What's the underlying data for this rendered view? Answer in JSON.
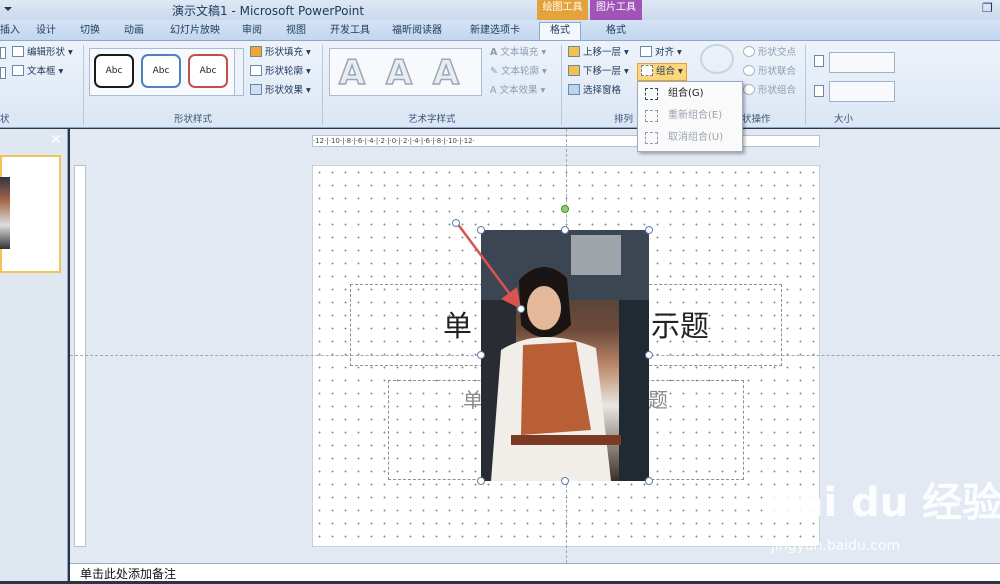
{
  "titlebar": {
    "title": "演示文稿1 - Microsoft PowerPoint",
    "restore_glyph": "❐",
    "contexts": {
      "drawing_tools": "绘图工具",
      "picture_tools": "图片工具"
    }
  },
  "tabs": [
    "插入",
    "设计",
    "切换",
    "动画",
    "幻灯片放映",
    "审阅",
    "视图",
    "开发工具",
    "福昕阅读器",
    "新建选项卡",
    "格式",
    "格式"
  ],
  "active_tab": "格式",
  "ribbon": {
    "insert_shapes": {
      "edit_shape": "编辑形状",
      "textbox": "文本框",
      "label": "状"
    },
    "shape_styles": {
      "thumb_labels": [
        "Abc",
        "Abc",
        "Abc"
      ],
      "fill": "形状填充",
      "outline": "形状轮廓",
      "effects": "形状效果",
      "label": "形状样式",
      "thumb_colors": [
        "#1a1a1a",
        "#4f81bd",
        "#c0504d"
      ]
    },
    "wordart": {
      "letters": [
        "A",
        "A",
        "A"
      ],
      "text_fill": "文本填充",
      "text_outline": "文本轮廓",
      "text_effects": "文本效果",
      "label": "艺术字样式"
    },
    "arrange": {
      "bring_forward": "上移一层",
      "send_backward": "下移一层",
      "selection_pane": "选择窗格",
      "align": "对齐",
      "group": "组合",
      "label": "排列"
    },
    "shape_ops": {
      "intersect": "形状交点",
      "union": "形状联合",
      "combine": "形状组合",
      "label": "状操作"
    },
    "size": {
      "label": "大小"
    }
  },
  "group_menu": {
    "items": [
      {
        "label": "组合(G)",
        "enabled": true
      },
      {
        "label": "重新组合(E)",
        "enabled": false
      },
      {
        "label": "取消组合(U)",
        "enabled": false
      }
    ]
  },
  "slide_panel": {
    "close": "✕"
  },
  "ruler": {
    "h_text": "·12·|·10·|·8·|·6·|·4·|·2·|·0·|·2·|·4·|·6·|·8·|·10·|·12·"
  },
  "slide": {
    "title_head": "单",
    "title_tail": "示题",
    "subtitle_head": "单",
    "subtitle_tail": "题"
  },
  "notes": {
    "placeholder": "单击此处添加备注"
  },
  "watermark": {
    "brand": "Bai du 经验",
    "url": "jingyan.baidu.com"
  }
}
